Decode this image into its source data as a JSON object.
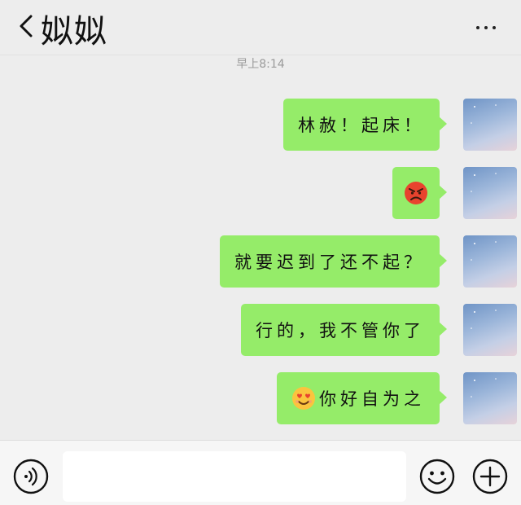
{
  "header": {
    "title": "姒姒",
    "back_icon": "chevron-left-icon",
    "more_icon": "more-dots-icon"
  },
  "chat": {
    "timestamp": "早上8:14",
    "messages": [
      {
        "text": "林赦！起床！",
        "emoji": null
      },
      {
        "text": "",
        "emoji": "angry-face"
      },
      {
        "text": "就要迟到了还不起？",
        "emoji": null
      },
      {
        "text": "行的，我不管你了",
        "emoji": null
      },
      {
        "text": "你好自为之",
        "emoji": "smiling-face-with-heart-eyes"
      }
    ]
  },
  "input_bar": {
    "voice_icon": "voice-icon",
    "input_value": "",
    "emoji_icon": "emoji-icon",
    "plus_icon": "plus-icon"
  },
  "colors": {
    "bubble": "#95ec69",
    "background": "#ededed"
  }
}
